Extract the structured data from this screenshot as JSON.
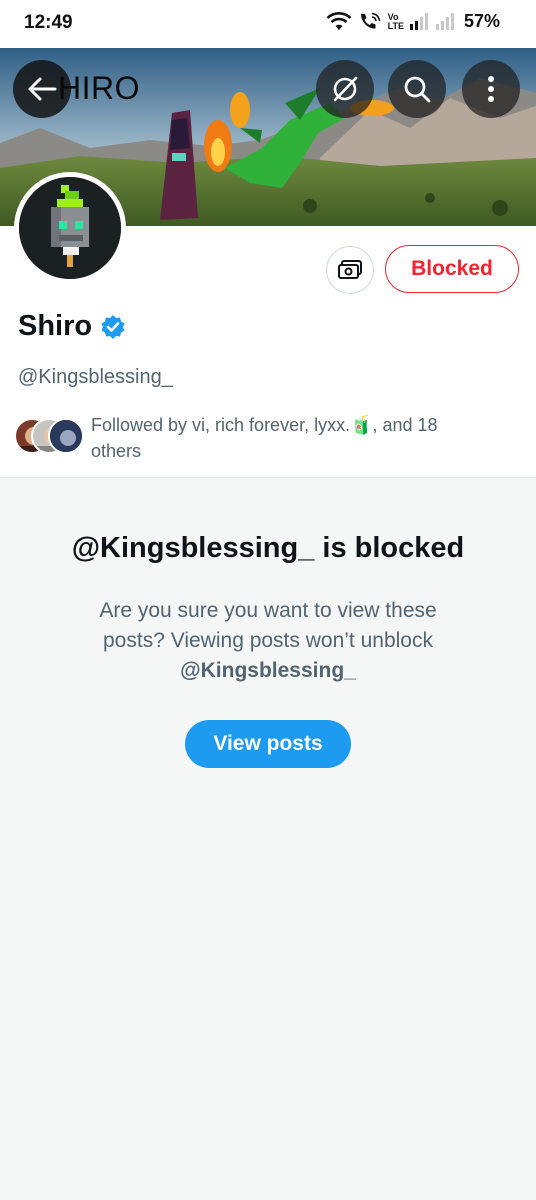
{
  "status_bar": {
    "time": "12:49",
    "volte_line1": "Vo",
    "volte_line2": "LTE",
    "battery": "57%"
  },
  "header": {
    "banner_title": "HIRO",
    "back_icon": "arrow-left-icon",
    "orb_icon": "grok-icon",
    "search_icon": "search-icon",
    "more_icon": "more-vertical-icon"
  },
  "profile": {
    "display_name": "Shiro",
    "verified_icon": "verified-badge-icon",
    "handle": "@Kingsblessing_",
    "blocked_label": "Blocked",
    "pay_icon": "money-icon",
    "followed_by": "Followed by vi, rich forever, lyxx.🧃, and 18 others"
  },
  "notice": {
    "title": "@Kingsblessing_ is blocked",
    "body": "Are you sure you want to view these posts? Viewing posts won’t unblock",
    "body_handle": "@Kingsblessing_",
    "view_label": "View posts"
  },
  "colors": {
    "accent": "#1d9bf0",
    "blocked_red": "#f4212e",
    "secondary_text": "#536471"
  }
}
